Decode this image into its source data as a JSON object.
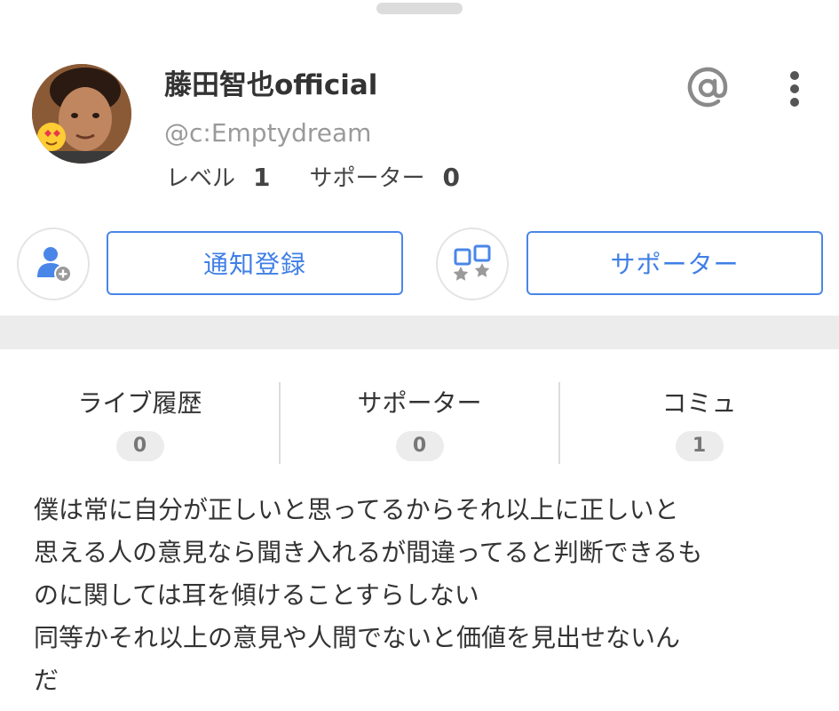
{
  "profile": {
    "name": "藤田智也official",
    "handle": "@c:Emptydream",
    "level_label": "レベル",
    "level_value": "1",
    "supporters_label": "サポーター",
    "supporters_value": "0"
  },
  "actions": {
    "notify_label": "通知登録",
    "supporter_label": "サポーター"
  },
  "tabs": [
    {
      "label": "ライブ履歴",
      "count": "0"
    },
    {
      "label": "サポーター",
      "count": "0"
    },
    {
      "label": "コミュ",
      "count": "1"
    }
  ],
  "bio": {
    "lines": [
      "僕は常に自分が正しいと思ってるからそれ以上に正しいと",
      "思える人の意見なら聞き入れるが間違ってると判断できるも",
      "のに関しては耳を傾けることすらしない",
      "同等かそれ以上の意見や人間でないと価値を見出せないん",
      "だ"
    ]
  },
  "icons": {
    "at": "at-icon",
    "more": "more-vertical-icon",
    "follow": "add-user-icon",
    "supporter": "supporter-stars-icon"
  },
  "colors": {
    "accent": "#4a86e8",
    "band": "#ececec",
    "secondary_text": "#9a9a9a"
  }
}
